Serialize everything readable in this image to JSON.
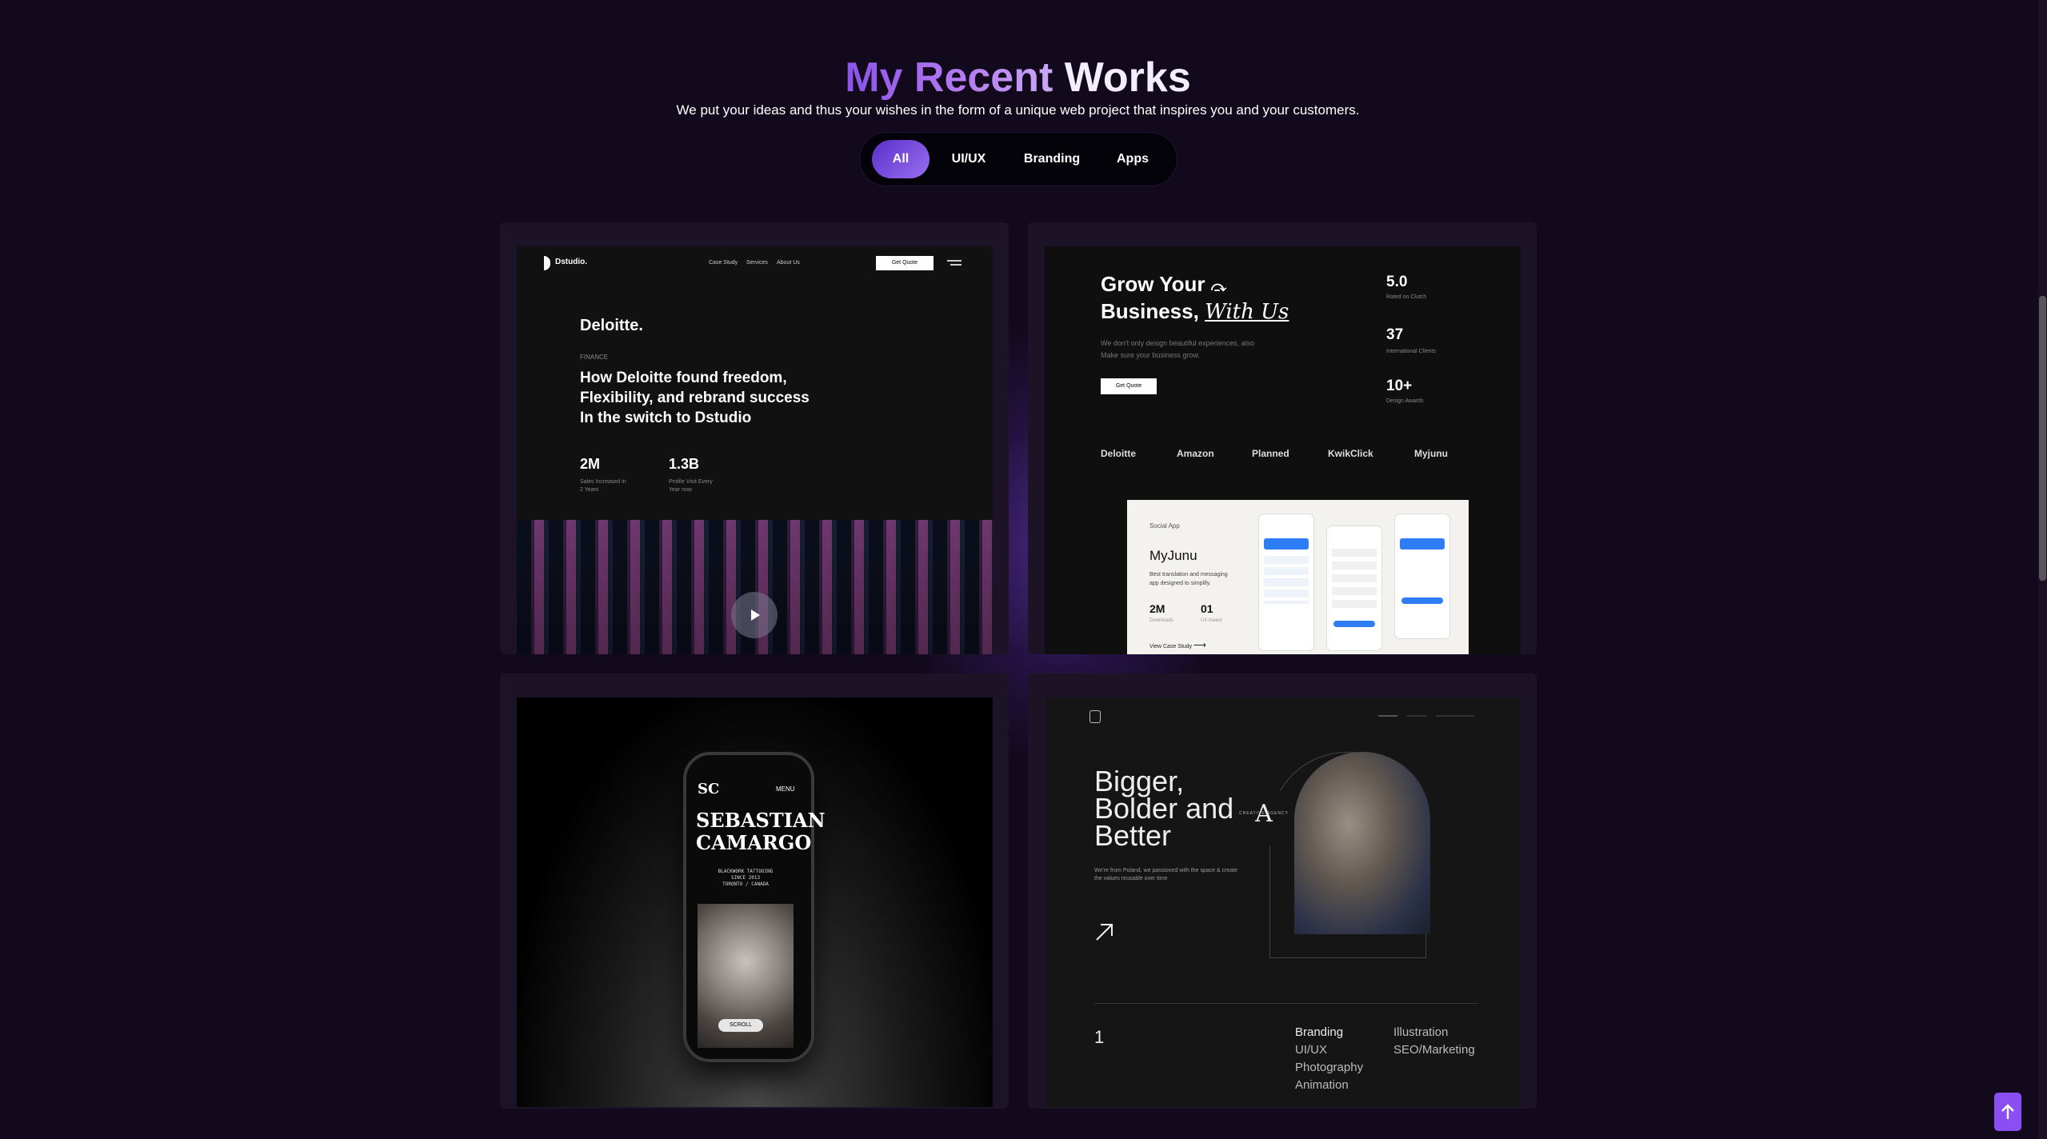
{
  "section": {
    "title_highlight": "My Recent",
    "title_rest": "Works",
    "subtitle": "We put your ideas and thus your wishes in the form of a unique web project that inspires you and your customers."
  },
  "filters": [
    {
      "label": "All",
      "active": true
    },
    {
      "label": "UI/UX",
      "active": false
    },
    {
      "label": "Branding",
      "active": false
    },
    {
      "label": "Apps",
      "active": false
    }
  ],
  "project1": {
    "brand": "Dstudio.",
    "nav": [
      "Case Study",
      "Services",
      "About Us"
    ],
    "cta": "Get Quote",
    "client": "Deloitte.",
    "category": "FINANCE",
    "headline": [
      "How Deloitte found freedom,",
      "Flexibility, and rebrand success",
      "In the switch to Dstudio"
    ],
    "stats": [
      {
        "value": "2M",
        "caption": [
          "Sales Increased in",
          "2 Years"
        ]
      },
      {
        "value": "1.3B",
        "caption": [
          "Profile Visit Every",
          "Year now"
        ]
      }
    ]
  },
  "project2": {
    "headline_line1": "Grow Your",
    "headline_line2_a": "Business,",
    "headline_line2_b": "With Us",
    "description": [
      "We don't only design beautiful experiences, also",
      "Make sure your business grow."
    ],
    "cta": "Get Quote",
    "stats": [
      {
        "value": "5.0",
        "caption": "Rated on Clutch"
      },
      {
        "value": "37",
        "caption": "International Clients"
      },
      {
        "value": "10+",
        "caption": "Design Awards"
      }
    ],
    "clients": [
      "Deloitte",
      "Amazon",
      "Planned",
      "KwikClick",
      "Myjunu"
    ],
    "case": {
      "tag": "Social App",
      "name": "MyJunu",
      "description": [
        "Best translation and messaging",
        "app designed to simplify."
      ],
      "stats": [
        {
          "value": "2M",
          "caption": "Downloads"
        },
        {
          "value": "01",
          "caption": "UX Award"
        }
      ],
      "link": "View Case Study"
    }
  },
  "project3": {
    "logo": "SC",
    "menu": "MENU",
    "name": [
      "SEBASTIAN",
      "CAMARGO"
    ],
    "details": [
      "BLACKWORK TATTOOING",
      "SINCE 2013",
      "TORONTO / CANADA"
    ],
    "scroll": "SCROLL"
  },
  "project4": {
    "headline": [
      "Bigger,",
      "Bolder and",
      "Better"
    ],
    "description": [
      "We're from Poland, we passioned with the space & create",
      "the values reusable over time"
    ],
    "badge_letter": "A",
    "badge_text": "CREATIVE AGENCY AWARD WINNERS",
    "index": "1",
    "services_col1": [
      "Branding",
      "UI/UX",
      "Photography",
      "Animation"
    ],
    "services_col2": [
      "Illustration",
      "SEO/Marketing"
    ]
  },
  "colors": {
    "background": "#12091c",
    "accent": "#8a4ff2",
    "card": "#1c1426"
  }
}
